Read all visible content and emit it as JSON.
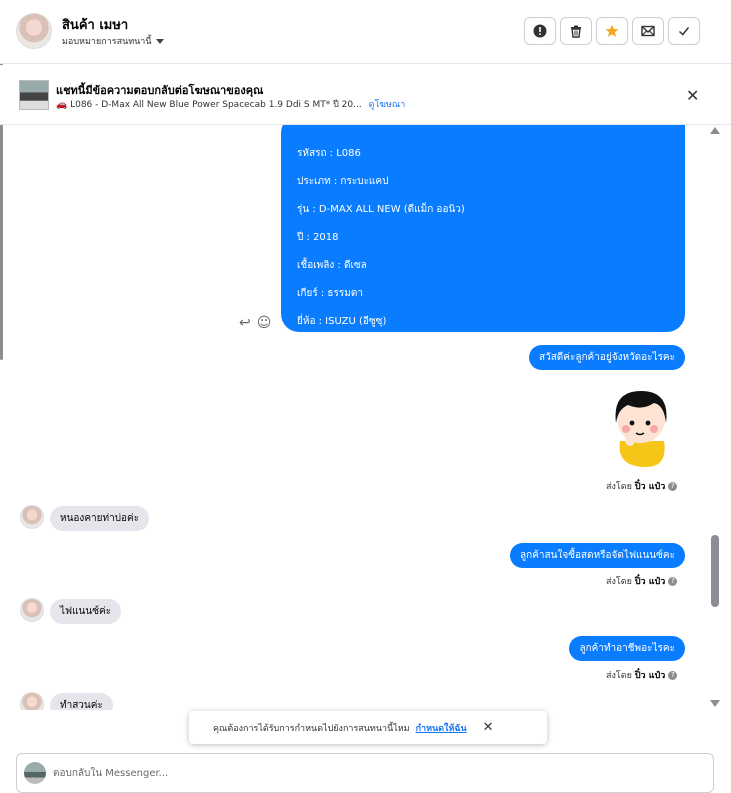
{
  "header": {
    "contact_name": "สินค้า เมษา",
    "assign_label": "มอบหมายการสนทนานี้",
    "buttons": [
      {
        "icon": "alert-icon"
      },
      {
        "icon": "trash-icon"
      },
      {
        "icon": "star-icon"
      },
      {
        "icon": "mark-unread-icon"
      },
      {
        "icon": "check-icon"
      }
    ]
  },
  "ad_banner": {
    "title": "แชทนี้มีข้อความตอบกลับต่อโฆษณาของคุณ",
    "subtitle": "L086 - D-Max All New Blue Power Spacecab 1.9 Ddi S MT* ปี 20...",
    "link": "ดูโฆษณา"
  },
  "messages": {
    "card_lines": [
      "รหัสรถ : L086",
      "ประเภท : กระบะแคป",
      "รุ่น : D-MAX ALL NEW (ดีแม็ก ออนิว)",
      "ปี : 2018",
      "เชื้อเพลิง : ดีเซล",
      "เกียร์ : ธรรมดา",
      "ยี่ห้อ : ISUZU (อีซูซุ)"
    ],
    "out_1": "สวัสดีค่ะลูกค้าอยู่จังหวัดอะไรคะ",
    "in_1": "หนองคายท่าบ่อค่ะ",
    "out_2": "ลูกค้าสนใจซื้อสดหรือจัดไฟแนนซ์คะ",
    "in_2": "ไฟแนนซ์ค่ะ",
    "out_3": "ลูกค้าทำอาชีพอะไรคะ",
    "in_3": "ทำสวนค่ะ",
    "sent_by_prefix": "ส่งโดย",
    "sent_by_name": "ปิ๋ว แป๋ว"
  },
  "toast": {
    "text": "คุณต้องการได้รับการกำหนดไปยังการสนทนานี้ไหม",
    "link": "กำหนดให้ฉัน"
  },
  "composer": {
    "placeholder": "ตอบกลับใน Messenger..."
  },
  "colors": {
    "outgoing_bubble": "#0a7cff",
    "incoming_bubble": "#e4e6eb",
    "star": "#f5a623",
    "link": "#1877f2"
  }
}
